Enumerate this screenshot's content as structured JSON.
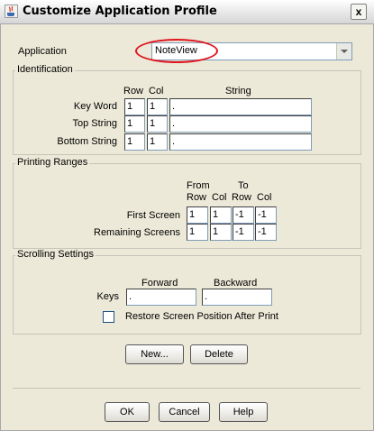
{
  "window": {
    "title": "Customize Application Profile",
    "close_glyph": "x"
  },
  "application": {
    "label": "Application",
    "value": "NoteView"
  },
  "identification": {
    "title": "Identification",
    "col_headers": {
      "row": "Row",
      "col": "Col",
      "string": "String"
    },
    "rows": [
      {
        "label": "Key Word",
        "row": "1",
        "col": "1",
        "string": "."
      },
      {
        "label": "Top String",
        "row": "1",
        "col": "1",
        "string": "."
      },
      {
        "label": "Bottom String",
        "row": "1",
        "col": "1",
        "string": "."
      }
    ]
  },
  "printing_ranges": {
    "title": "Printing Ranges",
    "headers": {
      "from": "From",
      "to": "To",
      "row1": "Row",
      "col1": "Col",
      "row2": "Row",
      "col2": "Col"
    },
    "rows": [
      {
        "label": "First Screen",
        "from_row": "1",
        "from_col": "1",
        "to_row": "-1",
        "to_col": "-1"
      },
      {
        "label": "Remaining Screens",
        "from_row": "1",
        "from_col": "1",
        "to_row": "-1",
        "to_col": "-1"
      }
    ]
  },
  "scrolling": {
    "title": "Scrolling Settings",
    "forward_label": "Forward",
    "backward_label": "Backward",
    "keys_label": "Keys",
    "forward_value": ".",
    "backward_value": ".",
    "restore_label": "Restore Screen Position After Print",
    "restore_checked": false
  },
  "buttons": {
    "new": "New...",
    "delete": "Delete",
    "ok": "OK",
    "cancel": "Cancel",
    "help": "Help"
  },
  "colors": {
    "highlight_ellipse": "#e0141e",
    "background": "#ece9d8"
  }
}
